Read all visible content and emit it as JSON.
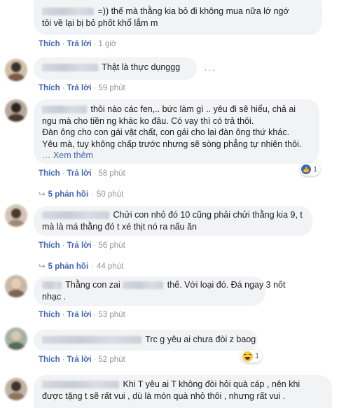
{
  "actions": {
    "like": "Thích",
    "reply": "Trả lời",
    "see_more": "… Xem thêm",
    "more": "···"
  },
  "colors": {
    "link": "#4267b2",
    "bubble": "#f2f3f5",
    "meta": "#90949c"
  },
  "comments": [
    {
      "lines": [
        "=)) thế mà thằng kia bỏ đi không mua nữa lớ ngớ",
        "tôi về lại bị bỏ phốt khổ lắm m"
      ],
      "time": "1 giờ"
    },
    {
      "lines": [
        "Thật là thực dụnggg"
      ],
      "time": "59 phút"
    },
    {
      "lines": [
        "thôi nào các fen,.. bức làm gì .. yêu đi sẽ hiểu, chả ai",
        "ngu mà cho tiền ng khác ko đâu. Có vay thì có trả thôi.",
        "Đàn ông cho con gái vật chất, con gái cho lại đàn ông thứ khác.",
        "Yêu mà, tuy không chấp trước nhưng sẽ sòng phẳng tự nhiên thôi."
      ],
      "time": "58 phút",
      "reaction_count": "1",
      "replies": "5 phản hồi",
      "replies_time": "50 phút"
    },
    {
      "lines": [
        "Chửi con nhỏ đó 10 cũng phải chửi thằng kia 9, t",
        "mà là má thằng đó t xé thịt nó ra nấu ăn"
      ],
      "time": "56 phút",
      "replies": "5 phản hồi",
      "replies_time": "44 phút"
    },
    {
      "lines": [
        "Thằng con zai",
        "thế. Với loại đó. Đá ngay 3 nốt",
        "nhạc ."
      ],
      "time": "53 phút"
    },
    {
      "lines": [
        "Trc g yêu ai chưa đòi z baog"
      ],
      "time": "52 phút",
      "reaction_count": "1"
    },
    {
      "lines": [
        "Khi T yêu ai T không đòi hỏi quà cáp , nên khi",
        "được tặng t sẽ rất vui , dù là món quà nhỏ thôi , nhưng rất vui ."
      ]
    }
  ]
}
